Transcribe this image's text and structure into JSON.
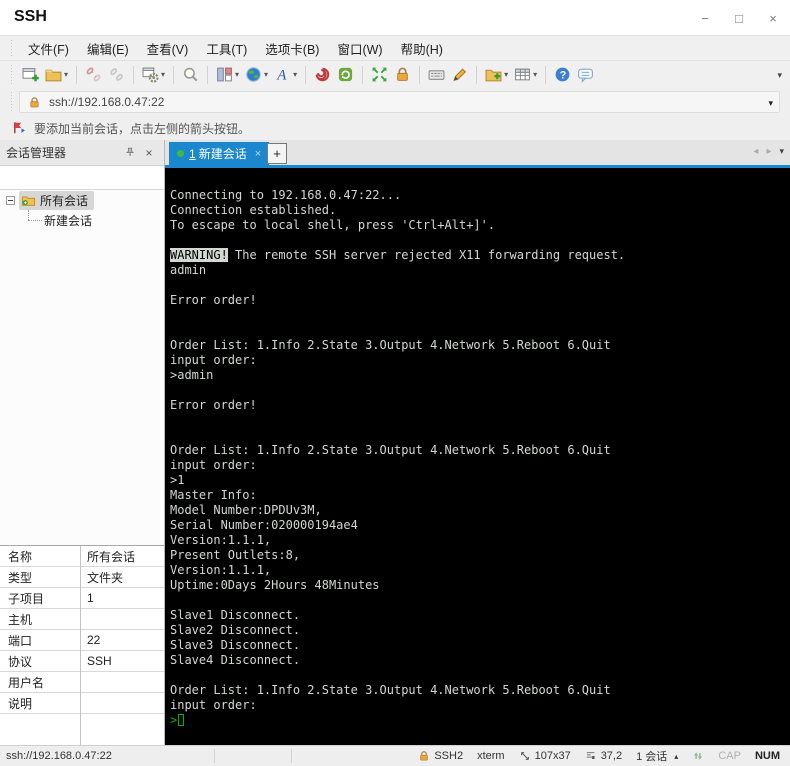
{
  "window": {
    "title": "SSH",
    "controls": {
      "minimize": "−",
      "maximize": "□",
      "close": "×"
    }
  },
  "menu": {
    "items": [
      "文件(F)",
      "编辑(E)",
      "查看(V)",
      "工具(T)",
      "选项卡(B)",
      "窗口(W)",
      "帮助(H)"
    ]
  },
  "toolbar": {
    "overflow": "▾",
    "buttons": [
      {
        "icon": "new-session-icon"
      },
      {
        "icon": "open-folder-icon",
        "dropdown": true,
        "sep_after": true
      },
      {
        "icon": "disconnect-icon",
        "disabled": true
      },
      {
        "icon": "reconnect-icon",
        "disabled": true,
        "sep_after": true
      },
      {
        "icon": "session-properties-icon",
        "dropdown": true,
        "sep_after": true
      },
      {
        "icon": "find-icon",
        "sep_after": true
      },
      {
        "icon": "layout-icon",
        "dropdown": true
      },
      {
        "icon": "web-icon",
        "dropdown": true
      },
      {
        "icon": "font-icon",
        "dropdown": true,
        "sep_after": true
      },
      {
        "icon": "trace-icon"
      },
      {
        "icon": "update-icon",
        "sep_after": true
      },
      {
        "icon": "fullscreen-icon"
      },
      {
        "icon": "lock-icon",
        "sep_after": true
      },
      {
        "icon": "keyboard-icon"
      },
      {
        "icon": "compose-icon",
        "sep_after": true
      },
      {
        "icon": "new-file-icon",
        "dropdown": true
      },
      {
        "icon": "grid-icon",
        "dropdown": true,
        "sep_after": true
      },
      {
        "icon": "help-icon"
      },
      {
        "icon": "feedback-icon"
      }
    ]
  },
  "address_bar": {
    "icon": "lock-icon",
    "value": "ssh://192.168.0.47:22",
    "dropdown": "▾"
  },
  "note_bar": {
    "icon": "flag-icon",
    "text": "要添加当前会话，点击左侧的箭头按钮。"
  },
  "session_manager": {
    "title": "会话管理器",
    "pin": "pin-icon",
    "close": "×",
    "search_value": "",
    "tree": [
      {
        "label": "所有会话",
        "selected": true,
        "expanded": true
      },
      {
        "label": "新建会话",
        "child": true
      }
    ]
  },
  "properties": {
    "rows": [
      {
        "label": "名称",
        "value": "所有会话"
      },
      {
        "label": "类型",
        "value": "文件夹"
      },
      {
        "label": "子项目",
        "value": "1"
      },
      {
        "label": "主机",
        "value": ""
      },
      {
        "label": "端口",
        "value": "22"
      },
      {
        "label": "协议",
        "value": "SSH"
      },
      {
        "label": "用户名",
        "value": ""
      },
      {
        "label": "说明",
        "value": ""
      }
    ]
  },
  "tab_bar": {
    "active_tab": {
      "dot_color": "#3dbb3d",
      "index": "1",
      "label": "新建会话",
      "close": "×"
    },
    "new_tab": "+",
    "nav_left": "◂",
    "nav_right": "▸",
    "overflow": "▾"
  },
  "terminal": {
    "bg": "#000000",
    "fg": "#d2d8d2",
    "cursor_color": "#00b400",
    "lines": [
      [
        {
          "t": "Connecting to 192.168.0.47:22..."
        }
      ],
      [
        {
          "t": "Connection established."
        }
      ],
      [
        {
          "t": "To escape to local shell, press 'Ctrl+Alt+]'."
        }
      ],
      [
        {
          "t": ""
        }
      ],
      [
        {
          "t": "WARNING!",
          "s": "inv"
        },
        {
          "t": " The remote SSH server rejected X11 forwarding request."
        }
      ],
      [
        {
          "t": "admin"
        }
      ],
      [
        {
          "t": ""
        }
      ],
      [
        {
          "t": "Error order!"
        }
      ],
      [
        {
          "t": ""
        }
      ],
      [
        {
          "t": ""
        }
      ],
      [
        {
          "t": "Order List: 1.Info 2.State 3.Output 4.Network 5.Reboot 6.Quit"
        }
      ],
      [
        {
          "t": "input order:"
        }
      ],
      [
        {
          "t": ">admin"
        }
      ],
      [
        {
          "t": ""
        }
      ],
      [
        {
          "t": "Error order!"
        }
      ],
      [
        {
          "t": ""
        }
      ],
      [
        {
          "t": ""
        }
      ],
      [
        {
          "t": "Order List: 1.Info 2.State 3.Output 4.Network 5.Reboot 6.Quit"
        }
      ],
      [
        {
          "t": "input order:"
        }
      ],
      [
        {
          "t": ">1"
        }
      ],
      [
        {
          "t": "Master Info:"
        }
      ],
      [
        {
          "t": "Model Number:DPDUv3M,"
        }
      ],
      [
        {
          "t": "Serial Number:020000194ae4"
        }
      ],
      [
        {
          "t": "Version:1.1.1,"
        }
      ],
      [
        {
          "t": "Present Outlets:8,"
        }
      ],
      [
        {
          "t": "Version:1.1.1,"
        }
      ],
      [
        {
          "t": "Uptime:0Days 2Hours 48Minutes"
        }
      ],
      [
        {
          "t": ""
        }
      ],
      [
        {
          "t": "Slave1 Disconnect."
        }
      ],
      [
        {
          "t": "Slave2 Disconnect."
        }
      ],
      [
        {
          "t": "Slave3 Disconnect."
        }
      ],
      [
        {
          "t": "Slave4 Disconnect."
        }
      ],
      [
        {
          "t": ""
        }
      ],
      [
        {
          "t": "Order List: 1.Info 2.State 3.Output 4.Network 5.Reboot 6.Quit"
        }
      ],
      [
        {
          "t": "input order:"
        }
      ],
      [
        {
          "t": ">",
          "s": "grn"
        },
        {
          "t": "",
          "s": "cur"
        }
      ]
    ]
  },
  "status_bar": {
    "session_url": "ssh://192.168.0.47:22",
    "items": [
      {
        "icon": "lock-icon",
        "label": "SSH2"
      },
      {
        "label": "xterm"
      },
      {
        "icon": "resize-icon",
        "label": "107x37"
      },
      {
        "icon": "cursor-pos-icon",
        "label": "37,2"
      },
      {
        "label": "1 会话",
        "caret": "▴"
      },
      {
        "icon": "updown-icon",
        "label": ""
      },
      {
        "label": "CAP",
        "dim": true
      },
      {
        "label": "NUM",
        "strong": true
      }
    ]
  },
  "colors": {
    "accent_blue": "#1b87cf",
    "tab_dot_green": "#3dbb3d",
    "warning_invert_bg": "#d2d8d2"
  }
}
